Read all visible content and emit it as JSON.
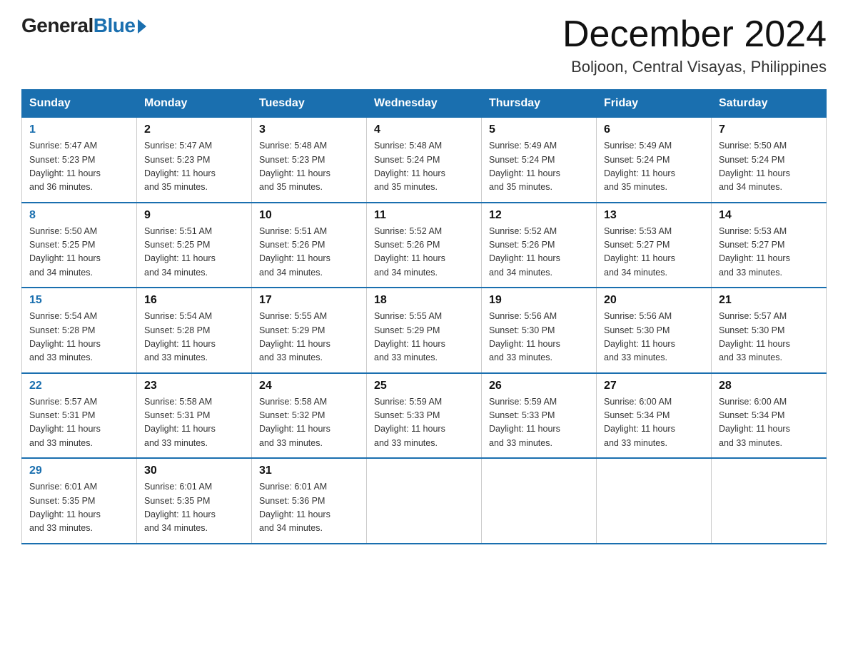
{
  "logo": {
    "general": "General",
    "blue": "Blue"
  },
  "title": "December 2024",
  "subtitle": "Boljoon, Central Visayas, Philippines",
  "weekdays": [
    "Sunday",
    "Monday",
    "Tuesday",
    "Wednesday",
    "Thursday",
    "Friday",
    "Saturday"
  ],
  "weeks": [
    [
      {
        "day": "1",
        "sunrise": "5:47 AM",
        "sunset": "5:23 PM",
        "daylight": "11 hours and 36 minutes."
      },
      {
        "day": "2",
        "sunrise": "5:47 AM",
        "sunset": "5:23 PM",
        "daylight": "11 hours and 35 minutes."
      },
      {
        "day": "3",
        "sunrise": "5:48 AM",
        "sunset": "5:23 PM",
        "daylight": "11 hours and 35 minutes."
      },
      {
        "day": "4",
        "sunrise": "5:48 AM",
        "sunset": "5:24 PM",
        "daylight": "11 hours and 35 minutes."
      },
      {
        "day": "5",
        "sunrise": "5:49 AM",
        "sunset": "5:24 PM",
        "daylight": "11 hours and 35 minutes."
      },
      {
        "day": "6",
        "sunrise": "5:49 AM",
        "sunset": "5:24 PM",
        "daylight": "11 hours and 35 minutes."
      },
      {
        "day": "7",
        "sunrise": "5:50 AM",
        "sunset": "5:24 PM",
        "daylight": "11 hours and 34 minutes."
      }
    ],
    [
      {
        "day": "8",
        "sunrise": "5:50 AM",
        "sunset": "5:25 PM",
        "daylight": "11 hours and 34 minutes."
      },
      {
        "day": "9",
        "sunrise": "5:51 AM",
        "sunset": "5:25 PM",
        "daylight": "11 hours and 34 minutes."
      },
      {
        "day": "10",
        "sunrise": "5:51 AM",
        "sunset": "5:26 PM",
        "daylight": "11 hours and 34 minutes."
      },
      {
        "day": "11",
        "sunrise": "5:52 AM",
        "sunset": "5:26 PM",
        "daylight": "11 hours and 34 minutes."
      },
      {
        "day": "12",
        "sunrise": "5:52 AM",
        "sunset": "5:26 PM",
        "daylight": "11 hours and 34 minutes."
      },
      {
        "day": "13",
        "sunrise": "5:53 AM",
        "sunset": "5:27 PM",
        "daylight": "11 hours and 34 minutes."
      },
      {
        "day": "14",
        "sunrise": "5:53 AM",
        "sunset": "5:27 PM",
        "daylight": "11 hours and 33 minutes."
      }
    ],
    [
      {
        "day": "15",
        "sunrise": "5:54 AM",
        "sunset": "5:28 PM",
        "daylight": "11 hours and 33 minutes."
      },
      {
        "day": "16",
        "sunrise": "5:54 AM",
        "sunset": "5:28 PM",
        "daylight": "11 hours and 33 minutes."
      },
      {
        "day": "17",
        "sunrise": "5:55 AM",
        "sunset": "5:29 PM",
        "daylight": "11 hours and 33 minutes."
      },
      {
        "day": "18",
        "sunrise": "5:55 AM",
        "sunset": "5:29 PM",
        "daylight": "11 hours and 33 minutes."
      },
      {
        "day": "19",
        "sunrise": "5:56 AM",
        "sunset": "5:30 PM",
        "daylight": "11 hours and 33 minutes."
      },
      {
        "day": "20",
        "sunrise": "5:56 AM",
        "sunset": "5:30 PM",
        "daylight": "11 hours and 33 minutes."
      },
      {
        "day": "21",
        "sunrise": "5:57 AM",
        "sunset": "5:30 PM",
        "daylight": "11 hours and 33 minutes."
      }
    ],
    [
      {
        "day": "22",
        "sunrise": "5:57 AM",
        "sunset": "5:31 PM",
        "daylight": "11 hours and 33 minutes."
      },
      {
        "day": "23",
        "sunrise": "5:58 AM",
        "sunset": "5:31 PM",
        "daylight": "11 hours and 33 minutes."
      },
      {
        "day": "24",
        "sunrise": "5:58 AM",
        "sunset": "5:32 PM",
        "daylight": "11 hours and 33 minutes."
      },
      {
        "day": "25",
        "sunrise": "5:59 AM",
        "sunset": "5:33 PM",
        "daylight": "11 hours and 33 minutes."
      },
      {
        "day": "26",
        "sunrise": "5:59 AM",
        "sunset": "5:33 PM",
        "daylight": "11 hours and 33 minutes."
      },
      {
        "day": "27",
        "sunrise": "6:00 AM",
        "sunset": "5:34 PM",
        "daylight": "11 hours and 33 minutes."
      },
      {
        "day": "28",
        "sunrise": "6:00 AM",
        "sunset": "5:34 PM",
        "daylight": "11 hours and 33 minutes."
      }
    ],
    [
      {
        "day": "29",
        "sunrise": "6:01 AM",
        "sunset": "5:35 PM",
        "daylight": "11 hours and 33 minutes."
      },
      {
        "day": "30",
        "sunrise": "6:01 AM",
        "sunset": "5:35 PM",
        "daylight": "11 hours and 34 minutes."
      },
      {
        "day": "31",
        "sunrise": "6:01 AM",
        "sunset": "5:36 PM",
        "daylight": "11 hours and 34 minutes."
      },
      null,
      null,
      null,
      null
    ]
  ],
  "labels": {
    "sunrise": "Sunrise:",
    "sunset": "Sunset:",
    "daylight": "Daylight:"
  }
}
